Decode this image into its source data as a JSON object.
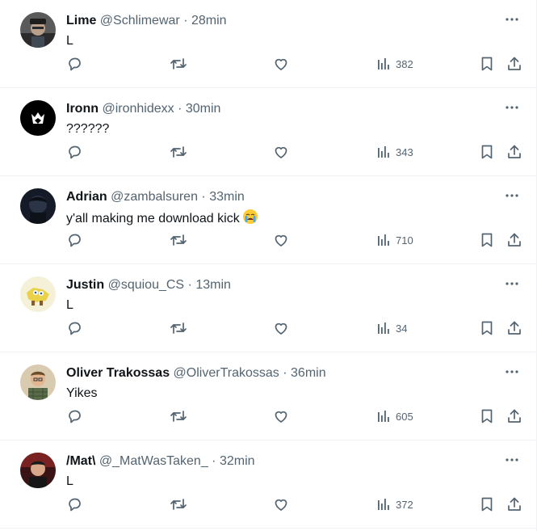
{
  "icon_color": "#536471",
  "tweets": [
    {
      "name": "Lime",
      "handle": "@Schlimewar",
      "separator": "·",
      "time": "28min",
      "text": "L",
      "views": "382",
      "avatar_icon": "avatar-man-hat",
      "avatar_color": "#3a3a3a"
    },
    {
      "name": "Ironn",
      "handle": "@ironhidexx",
      "separator": "·",
      "time": "30min",
      "text": "??????",
      "views": "343",
      "avatar_icon": "avatar-crown-logo",
      "avatar_color": "#000000"
    },
    {
      "name": "Adrian",
      "handle": "@zambalsuren",
      "separator": "·",
      "time": "33min",
      "text": "y'all making me download kick",
      "emoji": "😭",
      "views": "710",
      "avatar_icon": "avatar-dark-portrait",
      "avatar_color": "#1c2230"
    },
    {
      "name": "Justin",
      "handle": "@squiou_CS",
      "separator": "·",
      "time": "13min",
      "text": "L",
      "views": "34",
      "avatar_icon": "avatar-sponge",
      "avatar_color": "#f4f1d8"
    },
    {
      "name": "Oliver Trakossas",
      "handle": "@OliverTrakossas",
      "separator": "·",
      "time": "36min",
      "text": "Yikes",
      "views": "605",
      "avatar_icon": "avatar-man-plaid",
      "avatar_color": "#c9b89a"
    },
    {
      "name": "/Mat\\",
      "handle": "@_MatWasTaken_",
      "separator": "·",
      "time": "32min",
      "text": "L",
      "views": "372",
      "avatar_icon": "avatar-man-red",
      "avatar_color": "#6b1c1c"
    }
  ]
}
